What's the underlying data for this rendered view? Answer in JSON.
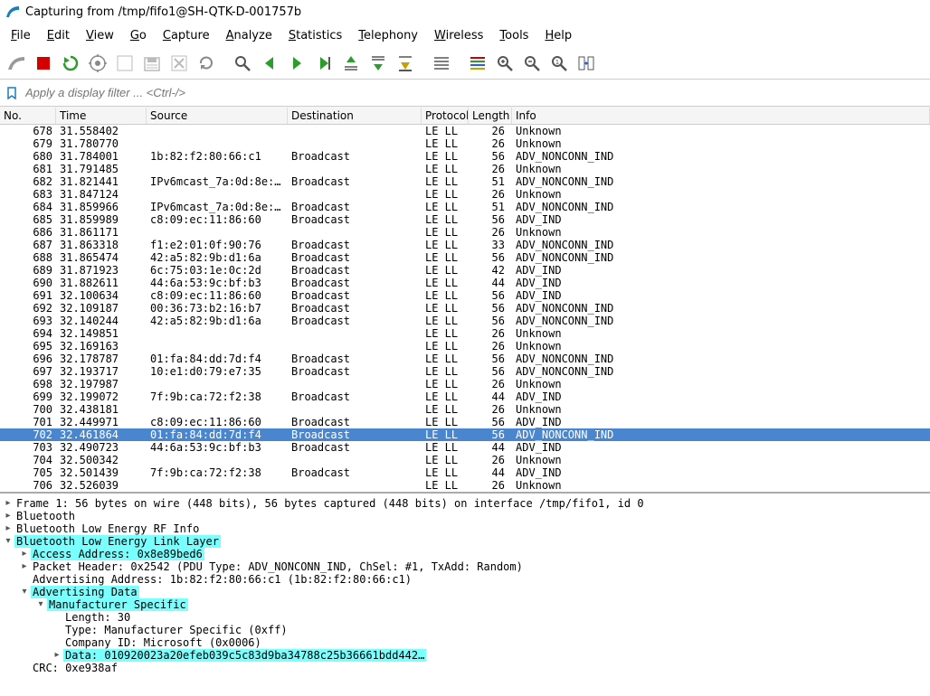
{
  "window": {
    "title": "Capturing from /tmp/fifo1@SH-QTK-D-001757b"
  },
  "menu": {
    "items": [
      "File",
      "Edit",
      "View",
      "Go",
      "Capture",
      "Analyze",
      "Statistics",
      "Telephony",
      "Wireless",
      "Tools",
      "Help"
    ]
  },
  "toolbar": {
    "icons": [
      "shark-fin",
      "stop",
      "restart",
      "options",
      "blank",
      "save",
      "close",
      "reload",
      "sep",
      "find",
      "prev",
      "next",
      "goto",
      "up",
      "down",
      "last",
      "sep",
      "auto-scroll",
      "sep",
      "color",
      "zoom-in",
      "zoom-out",
      "zoom-reset",
      "resize-cols"
    ]
  },
  "filter": {
    "placeholder": "Apply a display filter ... <Ctrl-/>"
  },
  "columns": [
    "No.",
    "Time",
    "Source",
    "Destination",
    "Protocol",
    "Length",
    "Info"
  ],
  "selected_no": 702,
  "packets": [
    {
      "no": 678,
      "time": "31.558402",
      "src": "",
      "dst": "",
      "proto": "LE LL",
      "len": 26,
      "info": "Unknown"
    },
    {
      "no": 679,
      "time": "31.780770",
      "src": "",
      "dst": "",
      "proto": "LE LL",
      "len": 26,
      "info": "Unknown"
    },
    {
      "no": 680,
      "time": "31.784001",
      "src": "1b:82:f2:80:66:c1",
      "dst": "Broadcast",
      "proto": "LE LL",
      "len": 56,
      "info": "ADV_NONCONN_IND"
    },
    {
      "no": 681,
      "time": "31.791485",
      "src": "",
      "dst": "",
      "proto": "LE LL",
      "len": 26,
      "info": "Unknown"
    },
    {
      "no": 682,
      "time": "31.821441",
      "src": "IPv6mcast_7a:0d:8e:…",
      "dst": "Broadcast",
      "proto": "LE LL",
      "len": 51,
      "info": "ADV_NONCONN_IND"
    },
    {
      "no": 683,
      "time": "31.847124",
      "src": "",
      "dst": "",
      "proto": "LE LL",
      "len": 26,
      "info": "Unknown"
    },
    {
      "no": 684,
      "time": "31.859966",
      "src": "IPv6mcast_7a:0d:8e:…",
      "dst": "Broadcast",
      "proto": "LE LL",
      "len": 51,
      "info": "ADV_NONCONN_IND"
    },
    {
      "no": 685,
      "time": "31.859989",
      "src": "c8:09:ec:11:86:60",
      "dst": "Broadcast",
      "proto": "LE LL",
      "len": 56,
      "info": "ADV_IND"
    },
    {
      "no": 686,
      "time": "31.861171",
      "src": "",
      "dst": "",
      "proto": "LE LL",
      "len": 26,
      "info": "Unknown"
    },
    {
      "no": 687,
      "time": "31.863318",
      "src": "f1:e2:01:0f:90:76",
      "dst": "Broadcast",
      "proto": "LE LL",
      "len": 33,
      "info": "ADV_NONCONN_IND"
    },
    {
      "no": 688,
      "time": "31.865474",
      "src": "42:a5:82:9b:d1:6a",
      "dst": "Broadcast",
      "proto": "LE LL",
      "len": 56,
      "info": "ADV_NONCONN_IND"
    },
    {
      "no": 689,
      "time": "31.871923",
      "src": "6c:75:03:1e:0c:2d",
      "dst": "Broadcast",
      "proto": "LE LL",
      "len": 42,
      "info": "ADV_IND"
    },
    {
      "no": 690,
      "time": "31.882611",
      "src": "44:6a:53:9c:bf:b3",
      "dst": "Broadcast",
      "proto": "LE LL",
      "len": 44,
      "info": "ADV_IND"
    },
    {
      "no": 691,
      "time": "32.100634",
      "src": "c8:09:ec:11:86:60",
      "dst": "Broadcast",
      "proto": "LE LL",
      "len": 56,
      "info": "ADV_IND"
    },
    {
      "no": 692,
      "time": "32.109187",
      "src": "00:36:73:b2:16:b7",
      "dst": "Broadcast",
      "proto": "LE LL",
      "len": 56,
      "info": "ADV_NONCONN_IND"
    },
    {
      "no": 693,
      "time": "32.140244",
      "src": "42:a5:82:9b:d1:6a",
      "dst": "Broadcast",
      "proto": "LE LL",
      "len": 56,
      "info": "ADV_NONCONN_IND"
    },
    {
      "no": 694,
      "time": "32.149851",
      "src": "",
      "dst": "",
      "proto": "LE LL",
      "len": 26,
      "info": "Unknown"
    },
    {
      "no": 695,
      "time": "32.169163",
      "src": "",
      "dst": "",
      "proto": "LE LL",
      "len": 26,
      "info": "Unknown"
    },
    {
      "no": 696,
      "time": "32.178787",
      "src": "01:fa:84:dd:7d:f4",
      "dst": "Broadcast",
      "proto": "LE LL",
      "len": 56,
      "info": "ADV_NONCONN_IND"
    },
    {
      "no": 697,
      "time": "32.193717",
      "src": "10:e1:d0:79:e7:35",
      "dst": "Broadcast",
      "proto": "LE LL",
      "len": 56,
      "info": "ADV_NONCONN_IND"
    },
    {
      "no": 698,
      "time": "32.197987",
      "src": "",
      "dst": "",
      "proto": "LE LL",
      "len": 26,
      "info": "Unknown"
    },
    {
      "no": 699,
      "time": "32.199072",
      "src": "7f:9b:ca:72:f2:38",
      "dst": "Broadcast",
      "proto": "LE LL",
      "len": 44,
      "info": "ADV_IND"
    },
    {
      "no": 700,
      "time": "32.438181",
      "src": "",
      "dst": "",
      "proto": "LE LL",
      "len": 26,
      "info": "Unknown"
    },
    {
      "no": 701,
      "time": "32.449971",
      "src": "c8:09:ec:11:86:60",
      "dst": "Broadcast",
      "proto": "LE LL",
      "len": 56,
      "info": "ADV_IND"
    },
    {
      "no": 702,
      "time": "32.461864",
      "src": "01:fa:84:dd:7d:f4",
      "dst": "Broadcast",
      "proto": "LE LL",
      "len": 56,
      "info": "ADV_NONCONN_IND"
    },
    {
      "no": 703,
      "time": "32.490723",
      "src": "44:6a:53:9c:bf:b3",
      "dst": "Broadcast",
      "proto": "LE LL",
      "len": 44,
      "info": "ADV_IND"
    },
    {
      "no": 704,
      "time": "32.500342",
      "src": "",
      "dst": "",
      "proto": "LE LL",
      "len": 26,
      "info": "Unknown"
    },
    {
      "no": 705,
      "time": "32.501439",
      "src": "7f:9b:ca:72:f2:38",
      "dst": "Broadcast",
      "proto": "LE LL",
      "len": 44,
      "info": "ADV_IND"
    },
    {
      "no": 706,
      "time": "32.526039",
      "src": "",
      "dst": "",
      "proto": "LE LL",
      "len": 26,
      "info": "Unknown"
    }
  ],
  "details": {
    "rows": [
      {
        "indent": 0,
        "arrow": "▸",
        "hl": false,
        "text": "Frame 1: 56 bytes on wire (448 bits), 56 bytes captured (448 bits) on interface /tmp/fifo1, id 0"
      },
      {
        "indent": 0,
        "arrow": "▸",
        "hl": false,
        "text": "Bluetooth"
      },
      {
        "indent": 0,
        "arrow": "▸",
        "hl": false,
        "text": "Bluetooth Low Energy RF Info"
      },
      {
        "indent": 0,
        "arrow": "▾",
        "hl": true,
        "text": "Bluetooth Low Energy Link Layer"
      },
      {
        "indent": 1,
        "arrow": "▸",
        "hl": true,
        "text": "Access Address: 0x8e89bed6"
      },
      {
        "indent": 1,
        "arrow": "▸",
        "hl": false,
        "text": "Packet Header: 0x2542 (PDU Type: ADV_NONCONN_IND, ChSel: #1, TxAdd: Random)"
      },
      {
        "indent": 1,
        "arrow": "",
        "hl": false,
        "text": "Advertising Address: 1b:82:f2:80:66:c1 (1b:82:f2:80:66:c1)"
      },
      {
        "indent": 1,
        "arrow": "▾",
        "hl": true,
        "text": "Advertising Data"
      },
      {
        "indent": 2,
        "arrow": "▾",
        "hl": true,
        "text": "Manufacturer Specific"
      },
      {
        "indent": 3,
        "arrow": "",
        "hl": false,
        "text": "Length: 30"
      },
      {
        "indent": 3,
        "arrow": "",
        "hl": false,
        "text": "Type: Manufacturer Specific (0xff)"
      },
      {
        "indent": 3,
        "arrow": "",
        "hl": false,
        "text": "Company ID: Microsoft (0x0006)"
      },
      {
        "indent": 3,
        "arrow": "▸",
        "hl": true,
        "text": "Data: 010920023a20efeb039c5c83d9ba34788c25b36661bdd442…"
      },
      {
        "indent": 1,
        "arrow": "",
        "hl": false,
        "text": "CRC: 0xe938af"
      }
    ]
  }
}
